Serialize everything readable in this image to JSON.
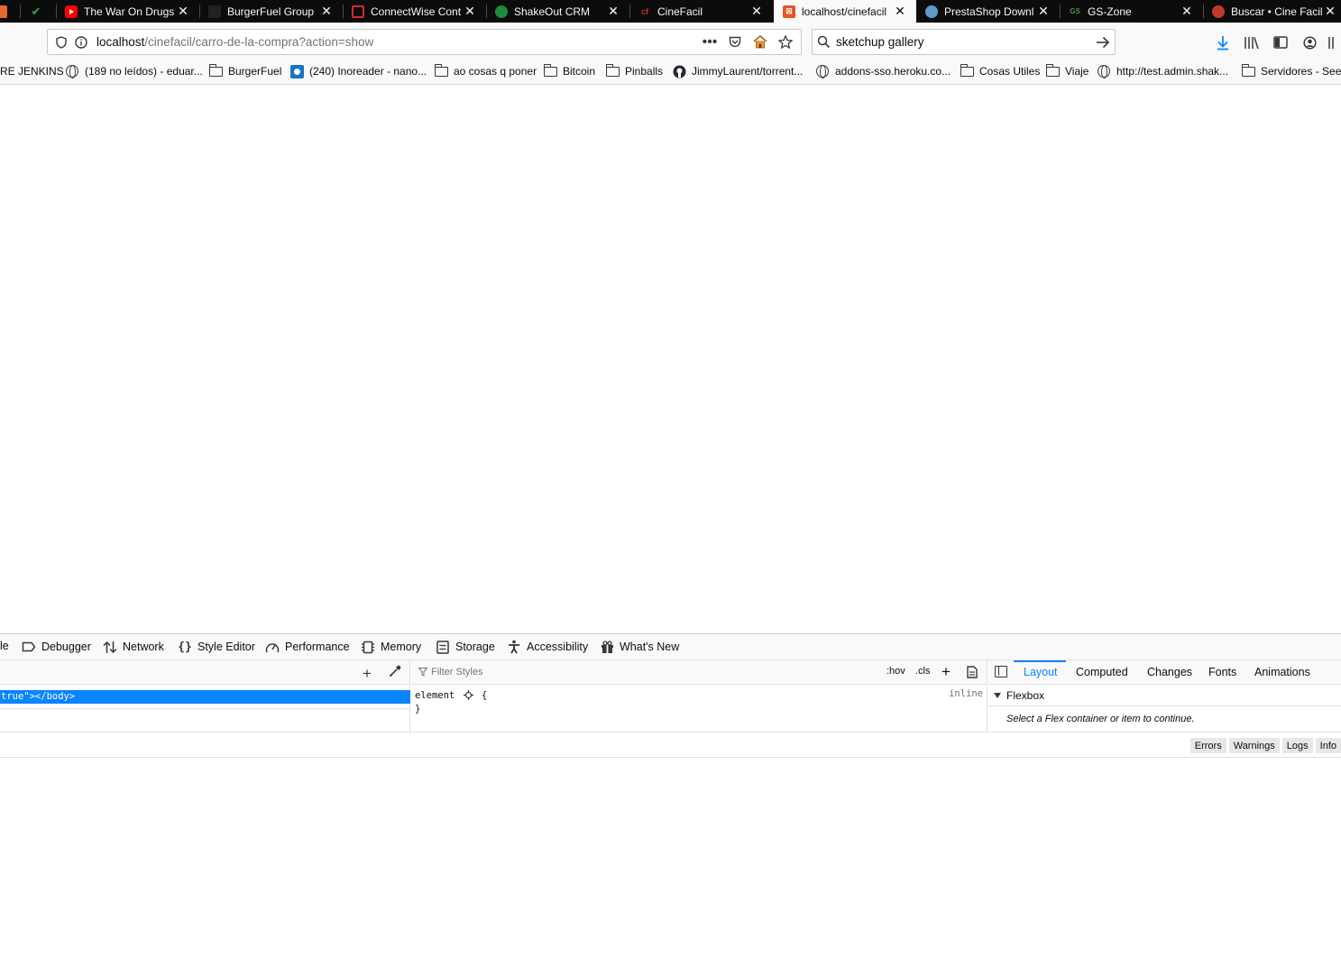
{
  "tabs": [
    {
      "title": "",
      "favicon": "#e66a2c"
    },
    {
      "title": "",
      "favicon": "#2eaa55"
    },
    {
      "title": "The War On Drugs",
      "favicon": "#ff0000"
    },
    {
      "title": "BurgerFuel Group",
      "favicon": "#222"
    },
    {
      "title": "ConnectWise Cont",
      "favicon": "#d92828"
    },
    {
      "title": "ShakeOut CRM",
      "favicon": "#1b8a3c"
    },
    {
      "title": "CineFacil",
      "favicon": "#7a1a1a"
    },
    {
      "title": "localhost/cinefacil",
      "favicon": "#e95420"
    },
    {
      "title": "PrestaShop Downl",
      "favicon": "#5c9bc8"
    },
    {
      "title": "GS-Zone",
      "favicon": "#2b6b2b"
    },
    {
      "title": "Buscar • Cine Facil",
      "favicon": "#c0392b"
    }
  ],
  "urlbar": {
    "host": "localhost",
    "path": "/cinefacil/carro-de-la-compra?action=show"
  },
  "search": {
    "value": "sketchup gallery"
  },
  "bookmarks": [
    "RE JENKINS",
    "(189 no leídos) - eduar...",
    "BurgerFuel",
    "(240) Inoreader - nano...",
    "ao cosas q poner",
    "Bitcoin",
    "Pinballs",
    "JimmyLaurent/torrent...",
    "addons-sso.heroku.co...",
    "Cosas Utiles",
    "Viaje",
    "http://test.admin.shak...",
    "Servidores - Seed"
  ],
  "devtools": {
    "tabs": [
      "le",
      "Debugger",
      "Network",
      "Style Editor",
      "Performance",
      "Memory",
      "Storage",
      "Accessibility",
      "What's New"
    ],
    "markup_line": "true\"></body>",
    "rules": {
      "filter_placeholder": "Filter Styles",
      "hov": ":hov",
      "cls": ".cls",
      "selector": "element",
      "open": "{",
      "close": "}",
      "origin": "inline"
    },
    "sidebar": {
      "tabs": [
        "Layout",
        "Computed",
        "Changes",
        "Fonts",
        "Animations"
      ],
      "section": "Flexbox",
      "message": "Select a Flex container or item to continue."
    },
    "console_filters": [
      "Errors",
      "Warnings",
      "Logs",
      "Info"
    ]
  },
  "colors": {
    "accent": "#0a84ff",
    "tabstrip": "#0c0c0d"
  }
}
